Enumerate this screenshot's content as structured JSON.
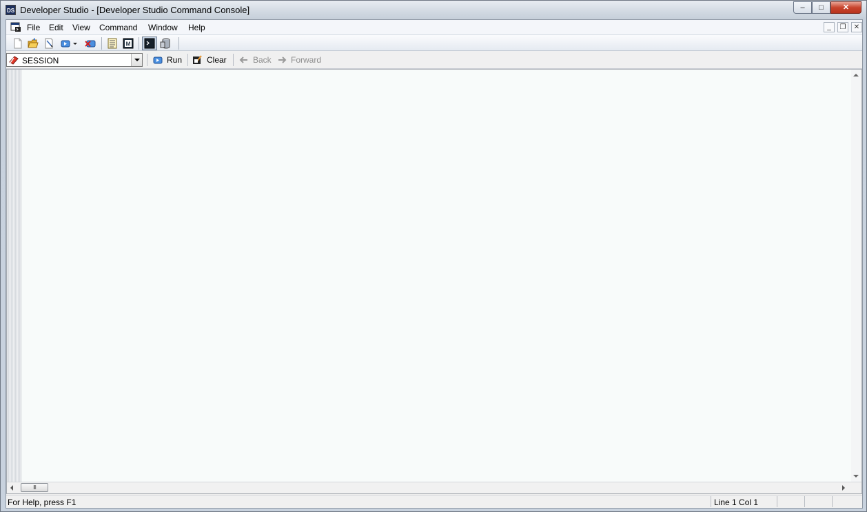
{
  "window": {
    "title": "Developer Studio - [Developer Studio Command Console]",
    "app_icon_text": "DS",
    "minimize_glyph": "‒",
    "maximize_glyph": "□",
    "close_glyph": "✕"
  },
  "menubar": {
    "items": [
      {
        "label": "File"
      },
      {
        "label": "Edit"
      },
      {
        "label": "View"
      },
      {
        "label": "Command"
      },
      {
        "label": "Window"
      },
      {
        "label": "Help"
      }
    ],
    "mdi_minimize_glyph": "_",
    "mdi_restore_glyph": "❐",
    "mdi_close_glyph": "✕"
  },
  "toolbar": {
    "icons": [
      "new-file-icon",
      "open-folder-icon",
      "edit-icon",
      "run-dropdown-icon",
      "stop-icon",
      "list-icon",
      "macro-m-icon",
      "console-icon",
      "database-icon"
    ],
    "macro_letter": "M"
  },
  "command_bar": {
    "session_value": "SESSION",
    "run_label": "Run",
    "clear_label": "Clear",
    "back_label": "Back",
    "forward_label": "Forward"
  },
  "editor": {
    "content": "",
    "scroll_thumb_glyph": "III"
  },
  "status": {
    "help_text": "For Help, press F1",
    "position_text": "Line 1 Col 1"
  },
  "colors": {
    "accent": "#c8442d",
    "editor_bg": "#f8fbfa",
    "chrome": "#f0f0f0"
  }
}
